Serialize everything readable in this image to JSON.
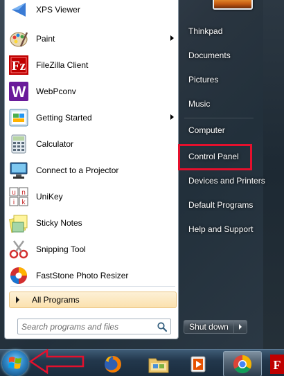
{
  "start_menu": {
    "programs": [
      {
        "label": "XPS Viewer",
        "icon": "xps-viewer-icon",
        "submenu": false
      },
      {
        "label": "Paint",
        "icon": "paint-icon",
        "submenu": true
      },
      {
        "label": "FileZilla Client",
        "icon": "filezilla-icon",
        "submenu": false
      },
      {
        "label": "WebPconv",
        "icon": "webpconv-icon",
        "submenu": false
      },
      {
        "label": "Getting Started",
        "icon": "getting-started-icon",
        "submenu": true
      },
      {
        "label": "Calculator",
        "icon": "calculator-icon",
        "submenu": false
      },
      {
        "label": "Connect to a Projector",
        "icon": "projector-icon",
        "submenu": false
      },
      {
        "label": "UniKey",
        "icon": "unikey-icon",
        "submenu": false
      },
      {
        "label": "Sticky Notes",
        "icon": "sticky-notes-icon",
        "submenu": false
      },
      {
        "label": "Snipping Tool",
        "icon": "snipping-tool-icon",
        "submenu": false
      },
      {
        "label": "FastStone Photo Resizer",
        "icon": "faststone-icon",
        "submenu": false
      }
    ],
    "all_programs": "All Programs",
    "search_placeholder": "Search programs and files",
    "places": [
      {
        "label": "Thinkpad"
      },
      {
        "label": "Documents"
      },
      {
        "label": "Pictures"
      },
      {
        "label": "Music"
      },
      {
        "label": "Computer"
      },
      {
        "label": "Control Panel",
        "highlighted": true
      },
      {
        "label": "Devices and Printers"
      },
      {
        "label": "Default Programs"
      },
      {
        "label": "Help and Support"
      }
    ],
    "shutdown_label": "Shut down"
  },
  "taskbar": {
    "items": [
      "start-orb-icon",
      "firefox-icon",
      "windows-explorer-icon",
      "media-player-icon",
      "chrome-icon",
      "filezilla-icon"
    ]
  },
  "colors": {
    "highlight_border": "#e5102d",
    "annotation_arrow": "#e5102d",
    "all_programs_bg": "#fbe1ae"
  }
}
